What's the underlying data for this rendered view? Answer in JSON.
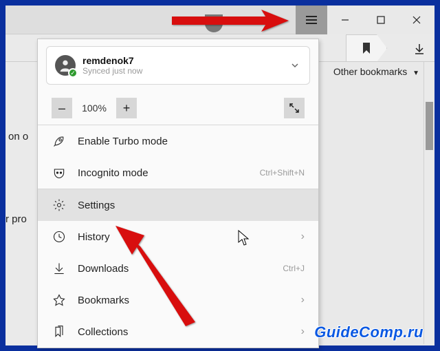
{
  "titlebar": {
    "minimize": "minimize",
    "maximize": "maximize",
    "close": "close"
  },
  "bookmarks_bar": {
    "other_bookmarks_label": "Other bookmarks"
  },
  "account": {
    "username": "remdenok7",
    "status": "Synced just now"
  },
  "zoom": {
    "minus": "–",
    "plus": "+",
    "value": "100%"
  },
  "menu": {
    "turbo": {
      "label": "Enable Turbo mode"
    },
    "incognito": {
      "label": "Incognito mode",
      "shortcut": "Ctrl+Shift+N"
    },
    "settings": {
      "label": "Settings"
    },
    "history": {
      "label": "History"
    },
    "downloads": {
      "label": "Downloads",
      "shortcut": "Ctrl+J"
    },
    "bookmarks": {
      "label": "Bookmarks"
    },
    "collections": {
      "label": "Collections"
    }
  },
  "bg_text": {
    "t1": "on o",
    "t2": "r pro"
  },
  "watermark": "GuideComp.ru",
  "colors": {
    "frame": "#0a2f9e",
    "arrow": "#d80e0e"
  }
}
